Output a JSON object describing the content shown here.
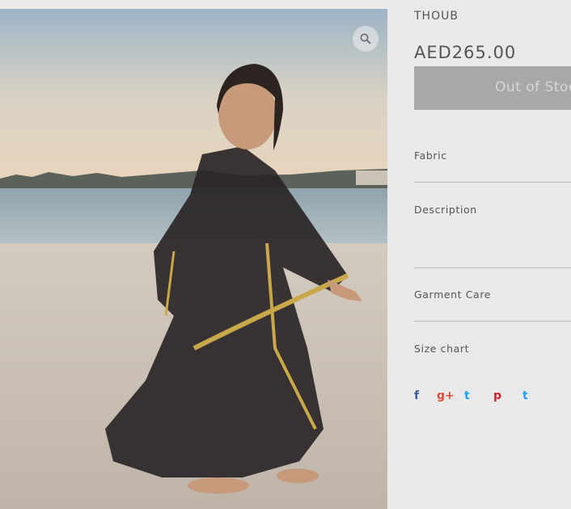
{
  "product": {
    "name": "THOUB",
    "price": "AED265.00",
    "stock_button": "Out of Stock"
  },
  "sections": [
    {
      "label": "Fabric"
    },
    {
      "label": "Description"
    },
    {
      "label": "Garment Care"
    },
    {
      "label": "Size chart"
    }
  ],
  "share": {
    "facebook": "f",
    "google_plus": "g+",
    "twitter": "t",
    "pinterest": "p",
    "tumblr": "t"
  },
  "colors": {
    "background": "#e9e9e9",
    "text": "#555555",
    "button_bg": "#a8a8a8",
    "button_text": "#d6d6d6",
    "divider": "#b9b9b9",
    "facebook": "#3b5998",
    "google_plus": "#dd4b39",
    "twitter": "#1da1f2",
    "pinterest": "#cb2027",
    "tumblr": "#1da1f2"
  }
}
